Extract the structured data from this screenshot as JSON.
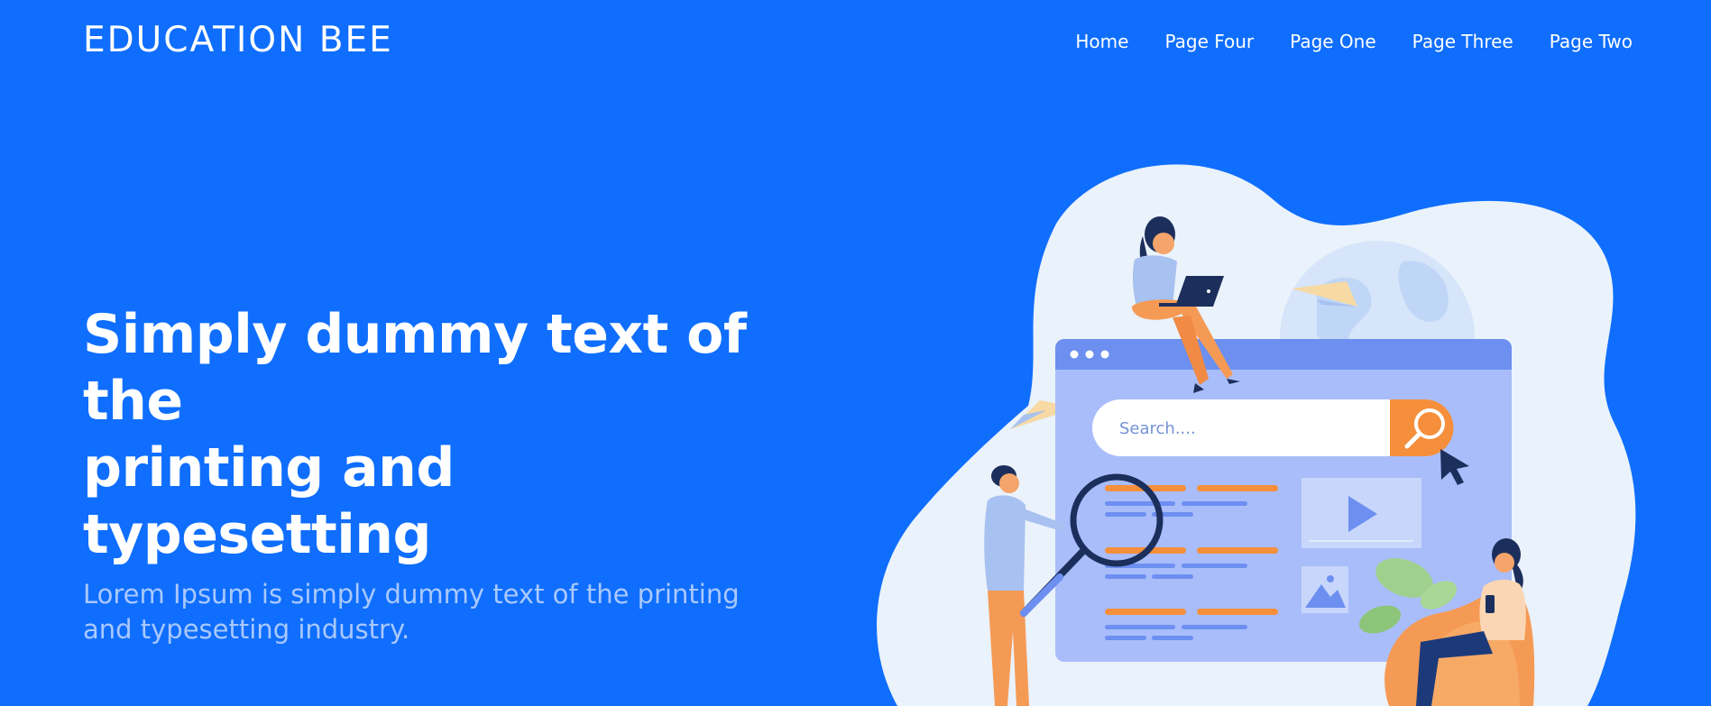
{
  "header": {
    "brand": "EDUCATION BEE",
    "nav": [
      "Home",
      "Page Four",
      "Page One",
      "Page Three",
      "Page Two"
    ]
  },
  "hero": {
    "title_line1": "Simply dummy text of the",
    "title_line2": "printing and typesetting",
    "subtitle": "Lorem Ipsum is simply dummy text of the printing and typesetting industry."
  },
  "illustration": {
    "search_placeholder": "Search...."
  },
  "colors": {
    "background": "#0f6efd",
    "subtitle": "#a9c8ff",
    "blob": "#eaf2fb",
    "browser": "#a9bdfb",
    "browser_bar": "#6c8ff0",
    "accent_orange": "#f58f3b",
    "navy": "#1c2f5c"
  }
}
